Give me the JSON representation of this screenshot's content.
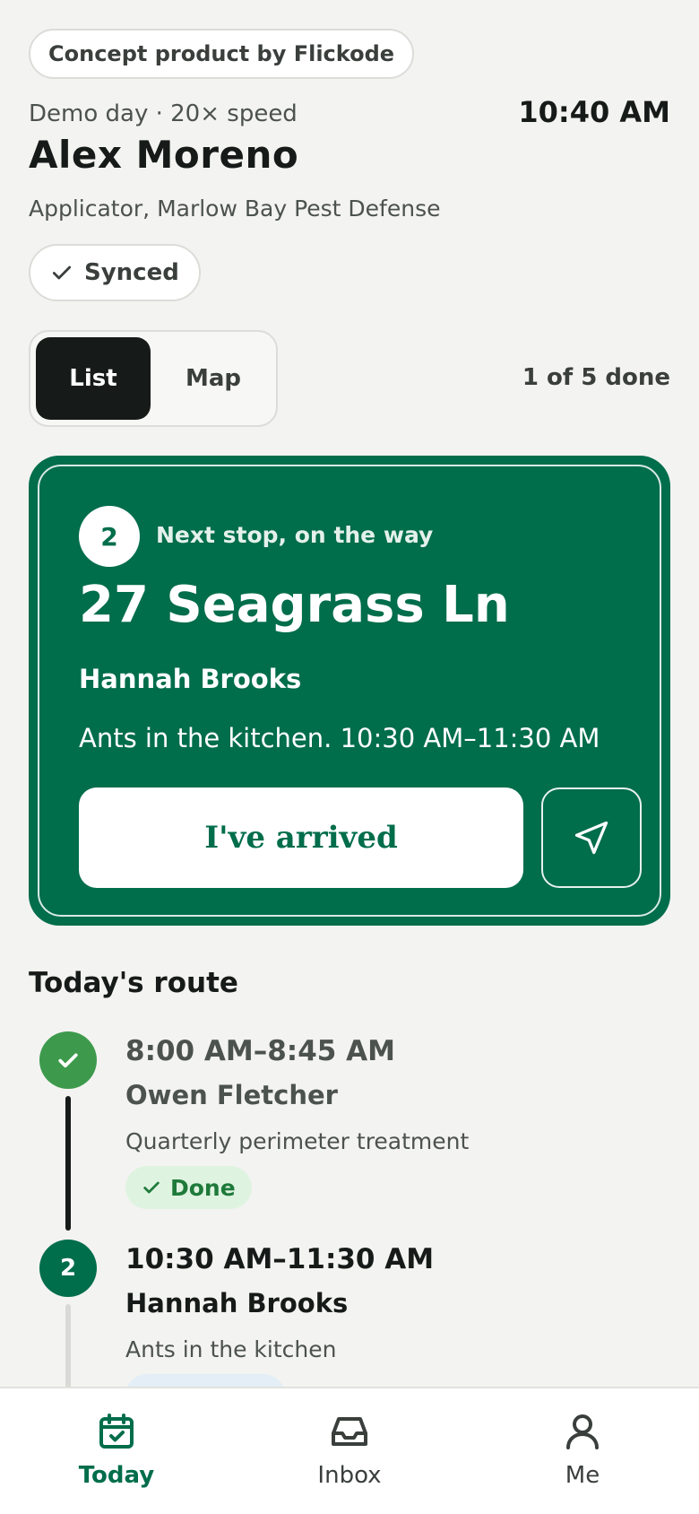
{
  "concept_label": "Concept product by Flickode",
  "header": {
    "demo_line": "Demo day · 20× speed",
    "time": "10:40 AM",
    "user_name": "Alex Moreno",
    "user_role": "Applicator, Marlow Bay Pest Defense",
    "sync_status": "Synced"
  },
  "view_toggle": {
    "list_label": "List",
    "map_label": "Map",
    "selected": "List"
  },
  "progress_text": "1 of 5 done",
  "next_stop": {
    "number": "2",
    "label": "Next stop, on the way",
    "address": "27 Seagrass Ln",
    "customer": "Hannah Brooks",
    "details": "Ants in the kitchen. 10:30 AM–11:30 AM",
    "arrived_label": "I've arrived",
    "navigate_icon": "navigation-arrow-icon"
  },
  "route": {
    "heading": "Today's route",
    "stops": [
      {
        "marker": "",
        "time": "8:00 AM–8:45 AM",
        "name": "Owen Fletcher",
        "service": "Quarterly perimeter treatment",
        "status": "Done"
      },
      {
        "marker": "2",
        "time": "10:30 AM–11:30 AM",
        "name": "Hannah Brooks",
        "service": "Ants in the kitchen"
      }
    ]
  },
  "tabs": [
    {
      "label": "Today",
      "icon": "calendar-check-icon",
      "active": true
    },
    {
      "label": "Inbox",
      "icon": "inbox-tray-icon",
      "active": false
    },
    {
      "label": "Me",
      "icon": "person-icon",
      "active": false
    }
  ],
  "colors": {
    "brand_green": "#006d4b",
    "done_green": "#3d9a4c",
    "background": "#f3f3f1",
    "ink": "#161a18"
  }
}
